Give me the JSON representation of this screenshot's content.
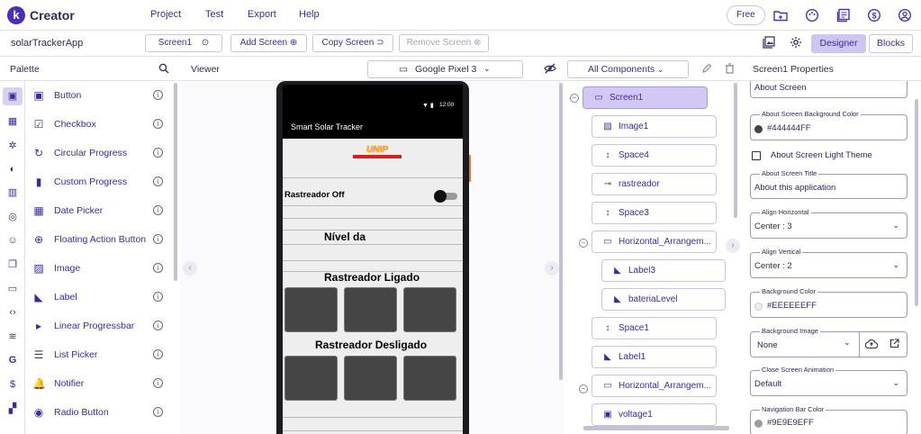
{
  "app": {
    "logo_letter": "k",
    "name": "Creator"
  },
  "menu": {
    "project": "Project",
    "test": "Test",
    "export": "Export",
    "help": "Help"
  },
  "top_right": {
    "free_label": "Free"
  },
  "project": {
    "name": "solarTrackerApp",
    "screen_select": "Screen1",
    "add_screen": "Add Screen",
    "copy_screen": "Copy Screen",
    "remove_screen": "Remove Screen",
    "designer": "Designer",
    "blocks": "Blocks"
  },
  "palette": {
    "title": "Palette",
    "items": [
      {
        "label": "Button",
        "icon": "button-icon",
        "glyph": "▣"
      },
      {
        "label": "Checkbox",
        "icon": "checkbox-icon",
        "glyph": "☑"
      },
      {
        "label": "Circular Progress",
        "icon": "circular-progress-icon",
        "glyph": "↻"
      },
      {
        "label": "Custom Progress",
        "icon": "custom-progress-icon",
        "glyph": "▮"
      },
      {
        "label": "Date Picker",
        "icon": "date-picker-icon",
        "glyph": "▦"
      },
      {
        "label": "Floating Action Button",
        "icon": "floating-action-button-icon",
        "glyph": "⊕"
      },
      {
        "label": "Image",
        "icon": "image-icon",
        "glyph": "▨"
      },
      {
        "label": "Label",
        "icon": "label-icon",
        "glyph": "◣"
      },
      {
        "label": "Linear Progressbar",
        "icon": "linear-progressbar-icon",
        "glyph": "▸"
      },
      {
        "label": "List Picker",
        "icon": "list-picker-icon",
        "glyph": "☰"
      },
      {
        "label": "Notifier",
        "icon": "notifier-icon",
        "glyph": "🔔"
      },
      {
        "label": "Radio Button",
        "icon": "radio-button-icon",
        "glyph": "◉"
      }
    ]
  },
  "viewer": {
    "title": "Viewer",
    "device": "Google Pixel 3",
    "phone": {
      "time": "12:00",
      "app_title": "Smart Solar Tracker",
      "logo_text": "UNIP",
      "switch_label": "Rastreador Off",
      "nivel_label": "Nível da",
      "ligado_label": "Rastreador Ligado",
      "desligado_label": "Rastreador Desligado"
    }
  },
  "components": {
    "dropdown": "All Components",
    "nodes": [
      {
        "label": "Screen1",
        "icon": "screen-icon",
        "glyph": "▭"
      },
      {
        "label": "Image1",
        "icon": "image-icon",
        "glyph": "▨"
      },
      {
        "label": "Space4",
        "icon": "space-icon",
        "glyph": "↕"
      },
      {
        "label": "rastreador",
        "icon": "switch-icon",
        "glyph": "⊸"
      },
      {
        "label": "Space3",
        "icon": "space-icon",
        "glyph": "↕"
      },
      {
        "label": "Horizontal_Arrangem...",
        "icon": "horizontal-arrangement-icon",
        "glyph": "▭"
      },
      {
        "label": "Label3",
        "icon": "label-icon",
        "glyph": "◣"
      },
      {
        "label": "bateriaLevel",
        "icon": "label-icon",
        "glyph": "◣"
      },
      {
        "label": "Space1",
        "icon": "space-icon",
        "glyph": "↕"
      },
      {
        "label": "Label1",
        "icon": "label-icon",
        "glyph": "◣"
      },
      {
        "label": "Horizontal_Arrangem...",
        "icon": "horizontal-arrangement-icon",
        "glyph": "▭"
      },
      {
        "label": "voltage1",
        "icon": "label-icon",
        "glyph": "▣"
      }
    ]
  },
  "properties": {
    "title": "Screen1 Properties",
    "about_screen": "About Screen",
    "about_bg_label": "About Screen Background Color",
    "about_bg_value": "#444444FF",
    "about_bg_color": "#444444",
    "light_theme": "About Screen Light Theme",
    "about_title_label": "About Screen Title",
    "about_title_value": "About this application",
    "align_h_label": "Align Horizontal",
    "align_h_value": "Center : 3",
    "align_v_label": "Align Vertical",
    "align_v_value": "Center : 2",
    "bg_color_label": "Background Color",
    "bg_color_value": "#EEEEEEFF",
    "bg_color": "#EEEEEE",
    "bg_image_label": "Background Image",
    "bg_image_value": "None",
    "close_anim_label": "Close Screen Animation",
    "close_anim_value": "Default",
    "nav_bar_label": "Navigation Bar Color",
    "nav_bar_value": "#9E9E9EFF",
    "nav_bar_color": "#9E9E9E"
  },
  "colors": {
    "accent": "#4b2fb8",
    "selected": "#d3c8f3"
  }
}
